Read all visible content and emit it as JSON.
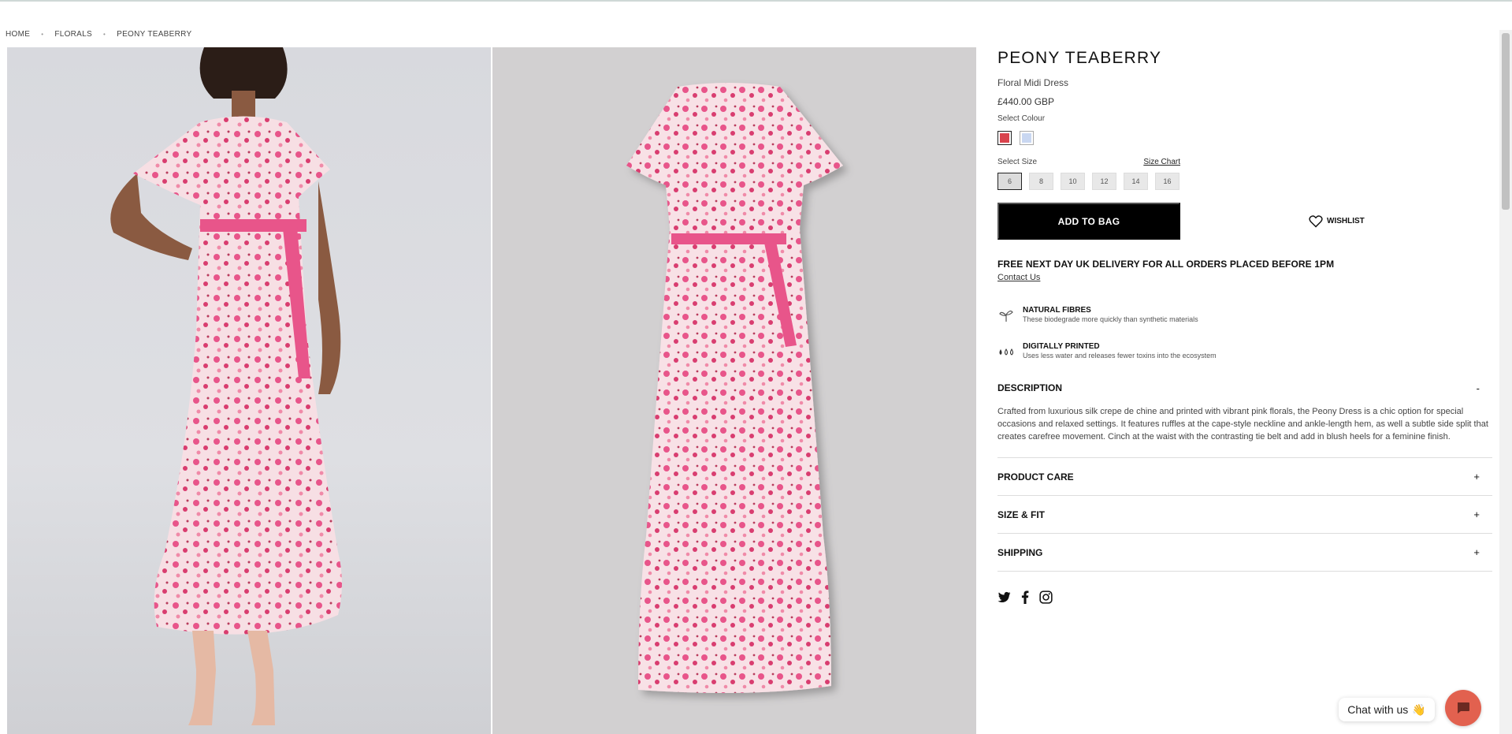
{
  "breadcrumb": [
    "HOME",
    "FLORALS",
    "PEONY TEABERRY"
  ],
  "product": {
    "title": "PEONY TEABERRY",
    "subtitle": "Floral Midi Dress",
    "price": "£440.00 GBP",
    "select_colour_label": "Select Colour",
    "colours": [
      "#d9434d",
      "#c9d7f1"
    ],
    "select_size_label": "Select Size",
    "size_chart_label": "Size Chart",
    "sizes": [
      "6",
      "8",
      "10",
      "12",
      "14",
      "16"
    ],
    "add_to_bag_label": "ADD TO BAG",
    "wishlist_label": "WISHLIST",
    "delivery_text": "FREE NEXT DAY UK DELIVERY FOR ALL ORDERS PLACED BEFORE 1PM",
    "contact_label": "Contact Us"
  },
  "features": [
    {
      "icon": "plant-icon",
      "title": "NATURAL FIBRES",
      "desc": "These biodegrade more quickly than synthetic materials"
    },
    {
      "icon": "water-drops-icon",
      "title": "DIGITALLY PRINTED",
      "desc": "Uses less water and releases fewer toxins into the ecosystem"
    }
  ],
  "accordion": {
    "description": {
      "label": "DESCRIPTION",
      "symbol": "-",
      "text": "Crafted from luxurious silk crepe de chine and printed with vibrant pink florals, the Peony Dress is a chic option for special occasions and relaxed settings. It features ruffles at the cape-style neckline and ankle-length hem, as well a subtle side split that creates carefree movement. Cinch at the waist with the contrasting tie belt and add in blush heels for a feminine finish."
    },
    "items": [
      {
        "label": "PRODUCT CARE",
        "symbol": "+"
      },
      {
        "label": "SIZE & FIT",
        "symbol": "+"
      },
      {
        "label": "SHIPPING",
        "symbol": "+"
      }
    ]
  },
  "social": [
    "twitter-icon",
    "facebook-icon",
    "instagram-icon"
  ],
  "chat": {
    "label": "Chat with us",
    "emoji": "👋"
  },
  "colors": {
    "button_bg": "#000000",
    "chat_accent": "#e2614f",
    "dress_pink": "#e8558a"
  }
}
